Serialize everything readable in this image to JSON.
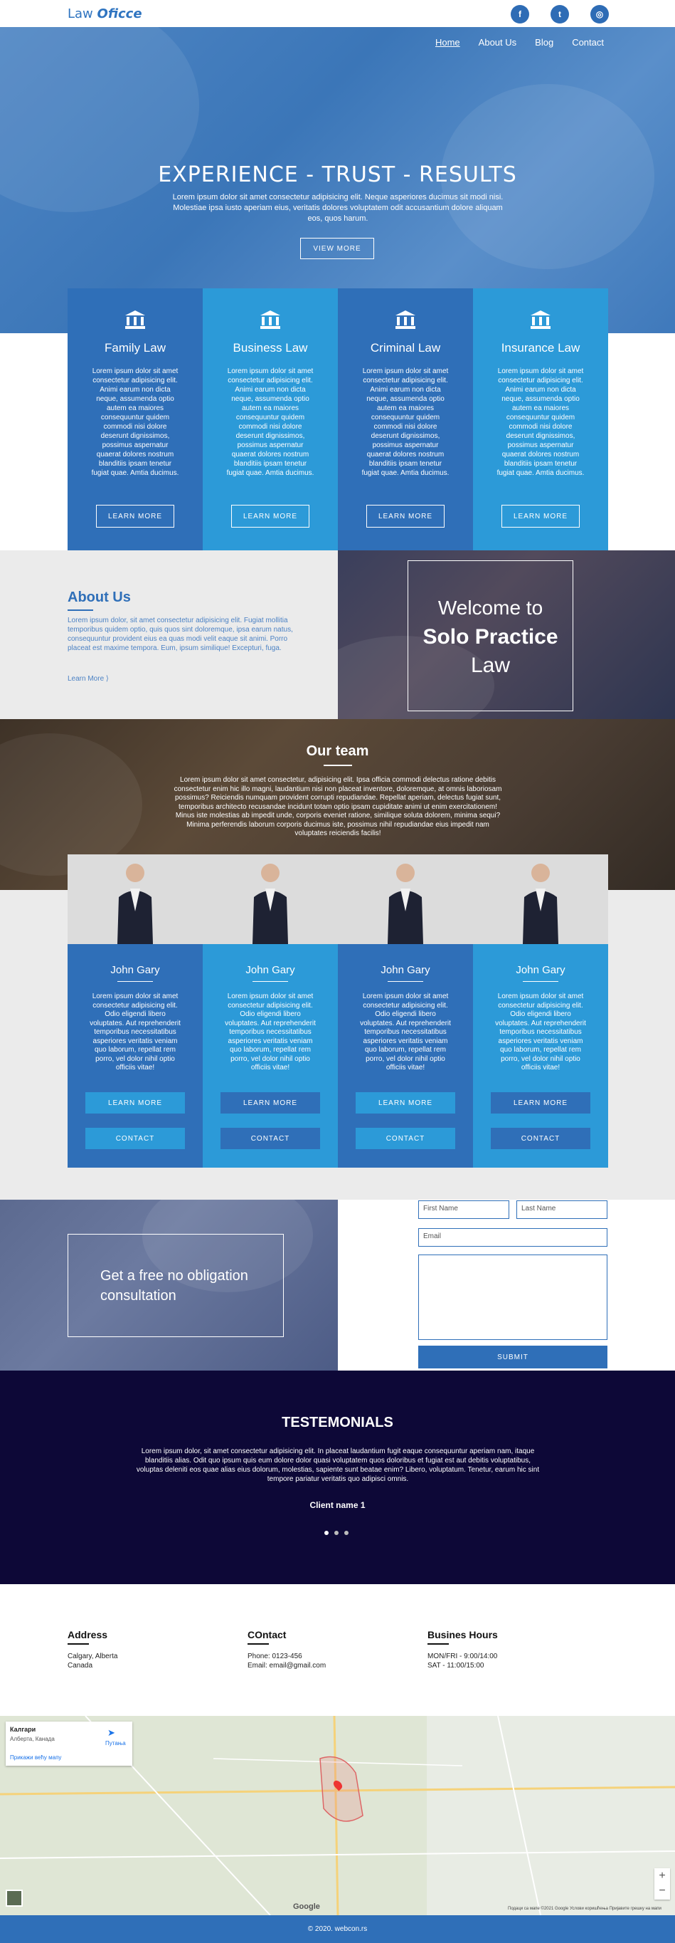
{
  "header": {
    "logo_plain": "Law",
    "logo_italic": "Oficce",
    "social": [
      {
        "icon": "facebook-icon",
        "glyph": "f"
      },
      {
        "icon": "twitter-icon",
        "glyph": "t"
      },
      {
        "icon": "instagram-icon",
        "glyph": "◎"
      }
    ]
  },
  "nav": {
    "items": [
      "Home",
      "About Us",
      "Blog",
      "Contact"
    ],
    "active": "Home"
  },
  "hero": {
    "title": "EXPERIENCE - TRUST - RESULTS",
    "text": "Lorem ipsum dolor sit amet consectetur adipisicing elit. Neque asperiores ducimus sit modi nisi. Molestiae ipsa iusto aperiam eius, veritatis dolores voluptatem odit accusantium dolore aliquam eos, quos harum.",
    "button": "VIEW MORE"
  },
  "services": [
    {
      "title": "Family Law",
      "text": "Lorem ipsum dolor sit amet consectetur adipisicing elit. Animi earum non dicta neque, assumenda optio autem ea maiores consequuntur quidem commodi nisi dolore deserunt dignissimos, possimus aspernatur quaerat dolores nostrum blanditiis ipsam tenetur fugiat quae. Amtia ducimus.",
      "button": "LEARN MORE"
    },
    {
      "title": "Business Law",
      "text": "Lorem ipsum dolor sit amet consectetur adipisicing elit. Animi earum non dicta neque, assumenda optio autem ea maiores consequuntur quidem commodi nisi dolore deserunt dignissimos, possimus aspernatur quaerat dolores nostrum blanditiis ipsam tenetur fugiat quae. Amtia ducimus.",
      "button": "LEARN MORE"
    },
    {
      "title": "Criminal Law",
      "text": "Lorem ipsum dolor sit amet consectetur adipisicing elit. Animi earum non dicta neque, assumenda optio autem ea maiores consequuntur quidem commodi nisi dolore deserunt dignissimos, possimus aspernatur quaerat dolores nostrum blanditiis ipsam tenetur fugiat quae. Amtia ducimus.",
      "button": "LEARN MORE"
    },
    {
      "title": "Insurance Law",
      "text": "Lorem ipsum dolor sit amet consectetur adipisicing elit. Animi earum non dicta neque, assumenda optio autem ea maiores consequuntur quidem commodi nisi dolore deserunt dignissimos, possimus aspernatur quaerat dolores nostrum blanditiis ipsam tenetur fugiat quae. Amtia ducimus.",
      "button": "LEARN MORE"
    }
  ],
  "about": {
    "title": "About Us",
    "text": "Lorem ipsum dolor, sit amet consectetur adipisicing elit. Fugiat mollitia temporibus quidem optio, quis quos sint doloremque, ipsa earum natus, consequuntur provident eius ea quas modi velit eaque sit animi. Porro placeat est maxime tempora. Eum, ipsum similique! Excepturi, fuga.",
    "more": "Learn More   ⟩"
  },
  "welcome": {
    "line1": "Welcome to",
    "line2": "Solo Practice",
    "line3": "Law"
  },
  "team": {
    "title": "Our team",
    "text": "Lorem ipsum dolor sit amet consectetur, adipisicing elit. Ipsa officia commodi delectus ratione debitis consectetur enim hic illo magni, laudantium nisi non placeat inventore, doloremque, at omnis laboriosam possimus? Reiciendis numquam provident corrupti repudiandae. Repellat aperiam, delectus fugiat sunt, temporibus architecto recusandae incidunt totam optio ipsam cupiditate animi ut enim exercitationem! Minus iste molestias ab impedit unde, corporis eveniet ratione, similique soluta dolorem, minima sequi? Minima perferendis laborum corporis ducimus iste, possimus nihil repudiandae eius impedit nam voluptates reiciendis facilis!",
    "members": [
      {
        "name": "John Gary",
        "text": "Lorem ipsum dolor sit amet consectetur adipisicing elit. Odio eligendi libero voluptates. Aut reprehenderit temporibus necessitatibus asperiores veritatis veniam quo laborum, repellat rem porro, vel dolor nihil optio officiis vitae!",
        "learn": "LEARN MORE",
        "contact": "CONTACT"
      },
      {
        "name": "John Gary",
        "text": "Lorem ipsum dolor sit amet consectetur adipisicing elit. Odio eligendi libero voluptates. Aut reprehenderit temporibus necessitatibus asperiores veritatis veniam quo laborum, repellat rem porro, vel dolor nihil optio officiis vitae!",
        "learn": "LEARN MORE",
        "contact": "CONTACT"
      },
      {
        "name": "John Gary",
        "text": "Lorem ipsum dolor sit amet consectetur adipisicing elit. Odio eligendi libero voluptates. Aut reprehenderit temporibus necessitatibus asperiores veritatis veniam quo laborum, repellat rem porro, vel dolor nihil optio officiis vitae!",
        "learn": "LEARN MORE",
        "contact": "CONTACT"
      },
      {
        "name": "John Gary",
        "text": "Lorem ipsum dolor sit amet consectetur adipisicing elit. Odio eligendi libero voluptates. Aut reprehenderit temporibus necessitatibus asperiores veritatis veniam quo laborum, repellat rem porro, vel dolor nihil optio officiis vitae!",
        "learn": "LEARN MORE",
        "contact": "CONTACT"
      }
    ]
  },
  "consult": {
    "text": "Get a free no obligation consultation",
    "first_name": "First Name",
    "last_name": "Last Name",
    "email": "Email",
    "submit": "SUBMIT"
  },
  "testimonials": {
    "title": "TESTEMONIALS",
    "text": "Lorem ipsum dolor, sit amet consectetur adipisicing elit. In placeat laudantium fugit eaque consequuntur aperiam nam, itaque blanditiis alias. Odit quo ipsum quis eum dolore dolor quasi voluptatem quos doloribus et fugiat est aut debitis voluptatibus, voluptas deleniti eos quae alias eius dolorum, molestias, sapiente sunt beatae enim? Libero, voluptatum. Tenetur, earum hic sint tempore pariatur veritatis quo adipisci omnis.",
    "client": "Client name 1"
  },
  "footer": {
    "address": {
      "title": "Address",
      "lines": [
        "Calgary, Alberta",
        "Canada"
      ]
    },
    "contact": {
      "title": "COntact",
      "lines": [
        "Phone: 0123-456",
        "Email: email@gmail.com"
      ]
    },
    "hours": {
      "title": "Busines Hours",
      "lines": [
        "MON/FRI - 9:00/14:00",
        "SAT - 11:00/15:00"
      ]
    }
  },
  "map": {
    "place": "Калгари",
    "region": "Алберта, Канада",
    "directions": "Путања",
    "larger_map": "Прикажи већу мапу",
    "attribution": "Подаци са мапе ©2021 Google   Услови коришћења   Пријавите грешку на мапи",
    "google": "Google"
  },
  "copyright": "© 2020. webcon.rs",
  "colors": {
    "dark_blue": "#2f6fb8",
    "light_blue": "#2c9ad8",
    "navy": "#0d0837"
  }
}
